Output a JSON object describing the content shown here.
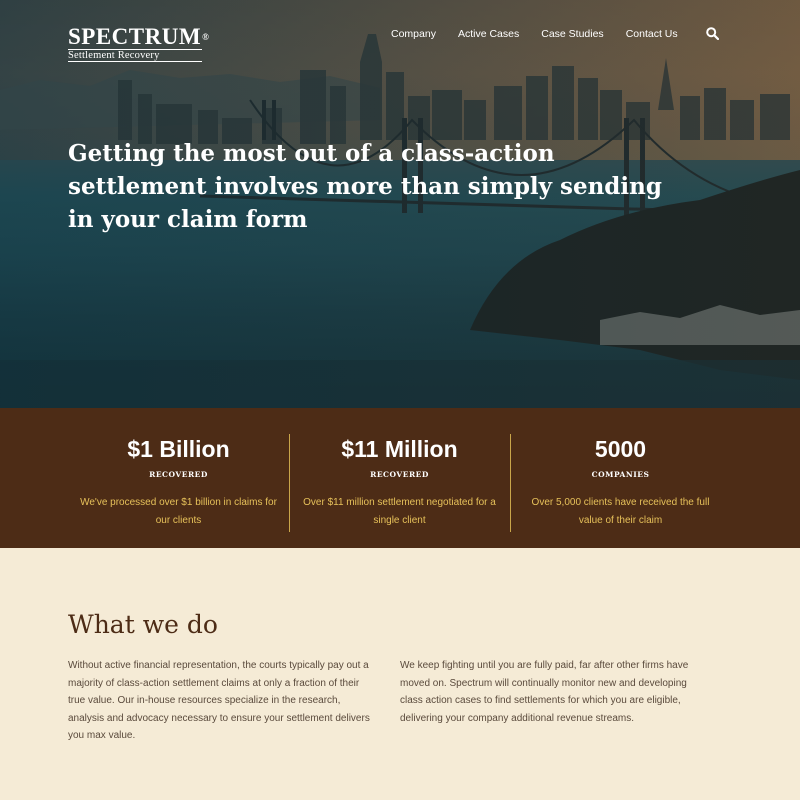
{
  "brand": {
    "name": "SPECTRUM",
    "registered_mark": "®",
    "tagline": "Settlement Recovery"
  },
  "nav": {
    "items": [
      "Company",
      "Active Cases",
      "Case Studies",
      "Contact Us"
    ],
    "search_icon": "search-icon"
  },
  "hero": {
    "title": "Getting the most out of a class-action settlement involves more than simply sending in your claim form"
  },
  "stats": [
    {
      "value": "$1 Billion",
      "caption": "RECOVERED",
      "description": "We've processed over $1 billion in claims for our clients"
    },
    {
      "value": "$11 Million",
      "caption": "RECOVERED",
      "description": "Over $11 million settlement negotiated for a single client"
    },
    {
      "value": "5000",
      "caption": "COMPANIES",
      "description": "Over 5,000 clients have received the full value of their claim"
    }
  ],
  "what_we_do": {
    "heading": "What we do",
    "paragraphs": [
      "Without active financial representation, the courts typically pay out a majority of class-action settlement claims at only a fraction of their true value. Our in-house resources specialize in the research, analysis and advocacy necessary to ensure your settlement delivers you max value.",
      "We keep fighting until you are fully paid, far after other firms have moved on. Spectrum will continually monitor new and developing class action cases to find settlements for which you are eligible, delivering your company additional revenue streams."
    ]
  },
  "colors": {
    "stats_bg": "#4d2c16",
    "stats_accent": "#e6c15a",
    "section_bg": "#f5ebd6",
    "heading": "#4d2c16"
  }
}
